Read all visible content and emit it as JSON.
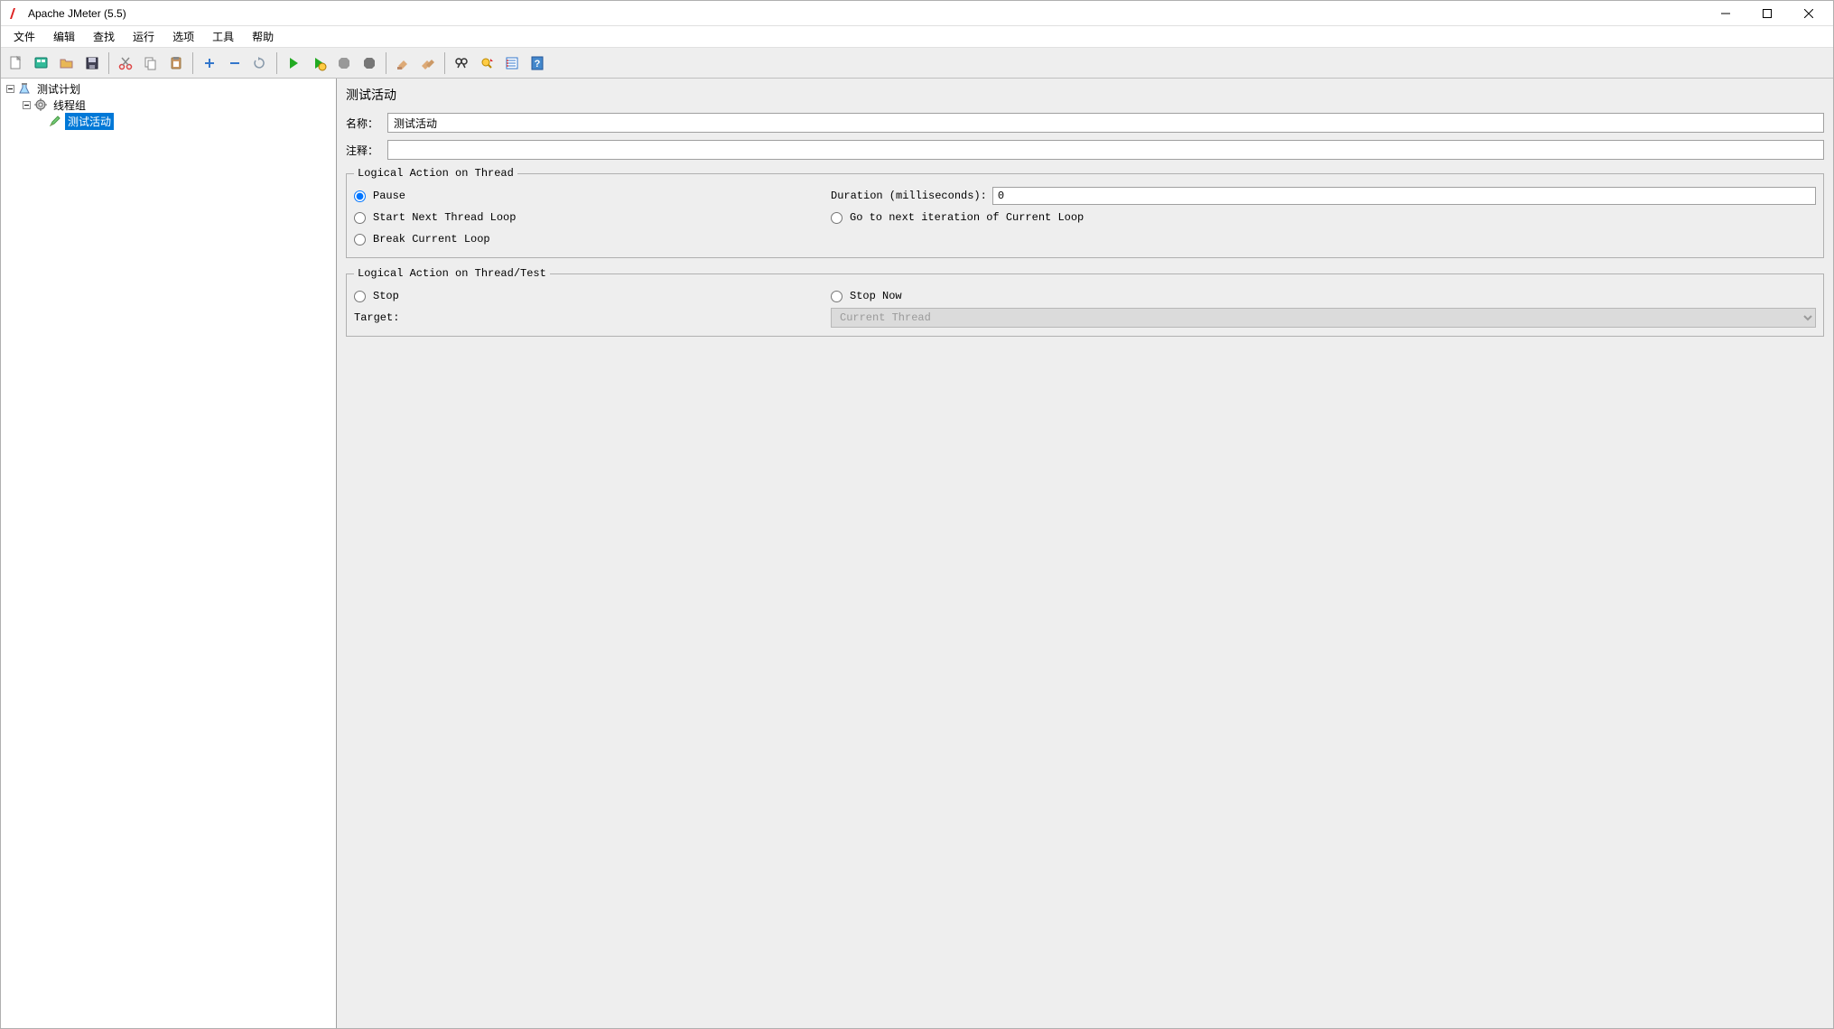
{
  "titlebar": {
    "title": "Apache JMeter (5.5)"
  },
  "menu": {
    "items": [
      "文件",
      "编辑",
      "查找",
      "运行",
      "选项",
      "工具",
      "帮助"
    ]
  },
  "toolbar": {
    "icons": [
      "new",
      "templates",
      "open",
      "save",
      "sep",
      "cut",
      "copy",
      "paste",
      "sep",
      "expand",
      "collapse",
      "toggle",
      "sep",
      "start",
      "start-no",
      "stop",
      "shutdown",
      "sep",
      "clear",
      "clear-all",
      "sep",
      "search",
      "reset-search",
      "function-helper",
      "help"
    ]
  },
  "tree": {
    "root": {
      "label": "测试计划"
    },
    "threadGroup": {
      "label": "线程组"
    },
    "testAction": {
      "label": "测试活动"
    }
  },
  "editor": {
    "title": "测试活动",
    "nameLabel": "名称：",
    "nameValue": "测试活动",
    "commentLabel": "注释：",
    "commentValue": "",
    "group1": {
      "legend": "Logical Action on Thread",
      "pause": "Pause",
      "startNext": "Start Next Thread Loop",
      "breakLoop": "Break Current Loop",
      "durationLabel": "Duration (milliseconds):",
      "durationValue": "0",
      "goNext": "Go to next iteration of Current Loop"
    },
    "group2": {
      "legend": "Logical Action on Thread/Test",
      "stop": "Stop",
      "stopNow": "Stop Now",
      "targetLabel": "Target:",
      "targetValue": "Current Thread"
    }
  }
}
